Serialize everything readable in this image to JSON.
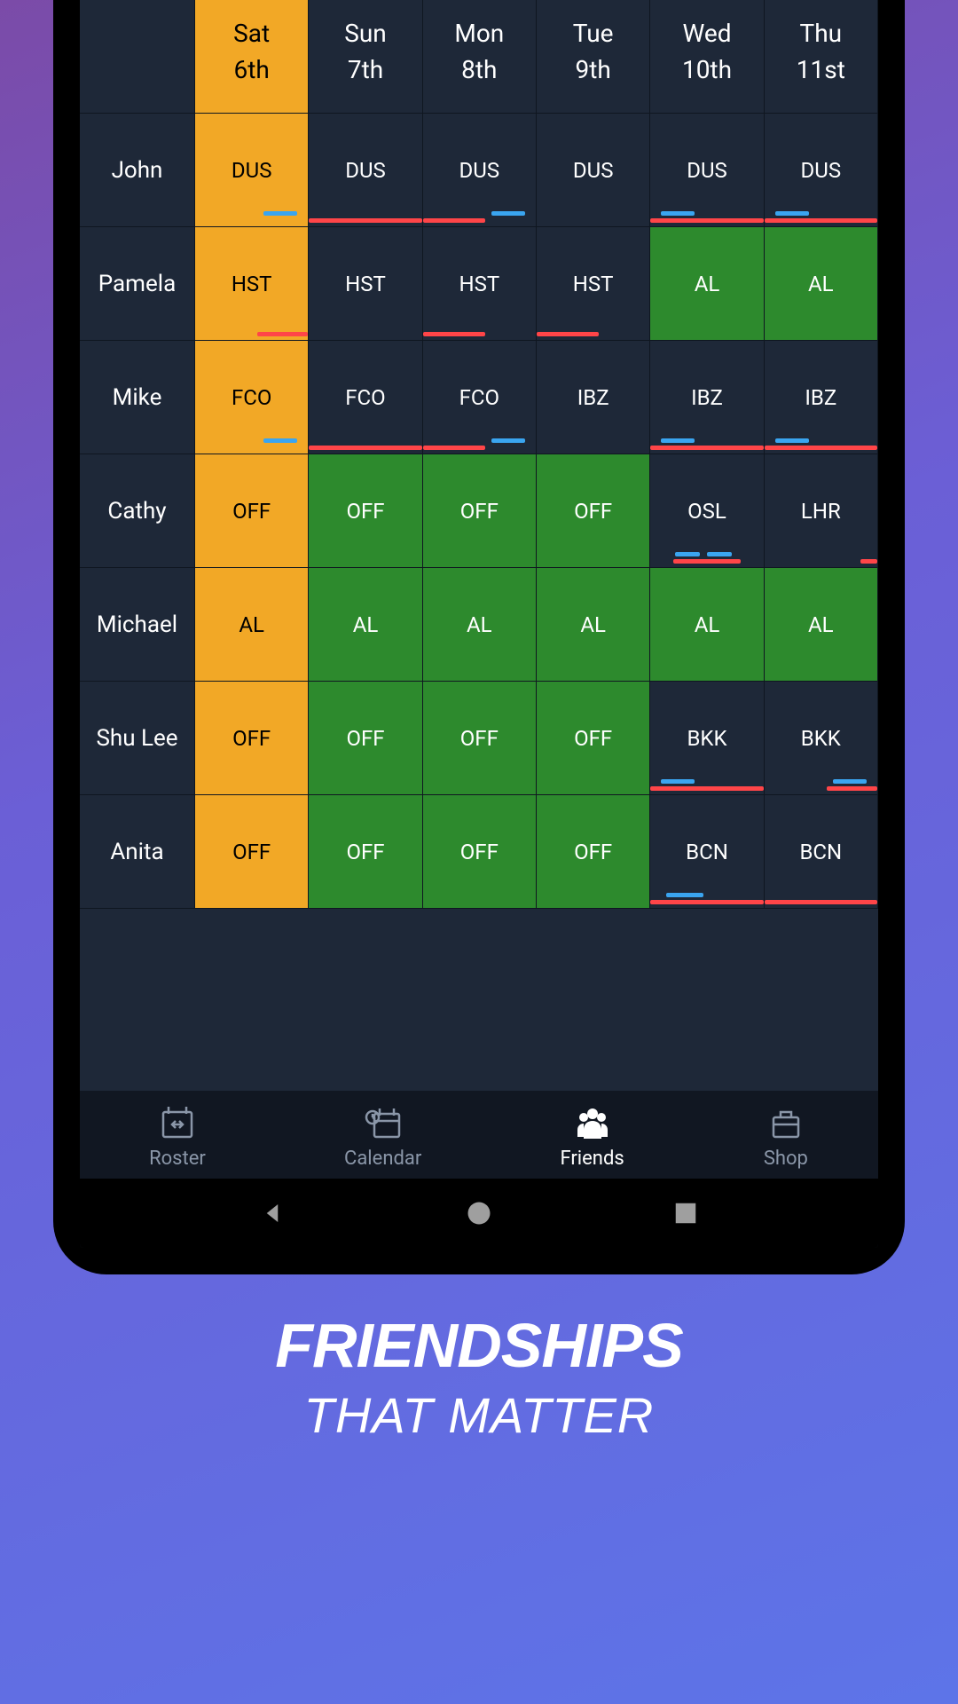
{
  "headers": [
    {
      "day": "Sat",
      "date": "6th",
      "highlight": true
    },
    {
      "day": "Sun",
      "date": "7th",
      "highlight": false
    },
    {
      "day": "Mon",
      "date": "8th",
      "highlight": false
    },
    {
      "day": "Tue",
      "date": "9th",
      "highlight": false
    },
    {
      "day": "Wed",
      "date": "10th",
      "highlight": false
    },
    {
      "day": "Thu",
      "date": "11st",
      "highlight": false
    }
  ],
  "rows": [
    {
      "name": "John",
      "cells": [
        {
          "text": "DUS",
          "style": "highlight",
          "blue": "right-short",
          "red": "none"
        },
        {
          "text": "DUS",
          "style": "",
          "blue": "",
          "red": "full"
        },
        {
          "text": "DUS",
          "style": "",
          "blue": "right-short",
          "red": "half-left"
        },
        {
          "text": "DUS",
          "style": "",
          "blue": "",
          "red": "none"
        },
        {
          "text": "DUS",
          "style": "",
          "blue": "left-short",
          "red": "full"
        },
        {
          "text": "DUS",
          "style": "",
          "blue": "left-short",
          "red": "full"
        }
      ]
    },
    {
      "name": "Pamela",
      "cells": [
        {
          "text": "HST",
          "style": "highlight",
          "blue": "",
          "red": "half-right"
        },
        {
          "text": "HST",
          "style": "",
          "blue": "",
          "red": "none"
        },
        {
          "text": "HST",
          "style": "",
          "blue": "",
          "red": "half-left"
        },
        {
          "text": "HST",
          "style": "",
          "blue": "",
          "red": "half-left"
        },
        {
          "text": "AL",
          "style": "green",
          "blue": "",
          "red": "none"
        },
        {
          "text": "AL",
          "style": "green",
          "blue": "",
          "red": "none"
        }
      ]
    },
    {
      "name": "Mike",
      "cells": [
        {
          "text": "FCO",
          "style": "highlight",
          "blue": "right-short",
          "red": "none"
        },
        {
          "text": "FCO",
          "style": "",
          "blue": "",
          "red": "full"
        },
        {
          "text": "FCO",
          "style": "",
          "blue": "right-short",
          "red": "half-left"
        },
        {
          "text": "IBZ",
          "style": "",
          "blue": "",
          "red": "none"
        },
        {
          "text": "IBZ",
          "style": "",
          "blue": "left-short",
          "red": "full"
        },
        {
          "text": "IBZ",
          "style": "",
          "blue": "left-short",
          "red": "full"
        }
      ]
    },
    {
      "name": "Cathy",
      "cells": [
        {
          "text": "OFF",
          "style": "highlight",
          "blue": "",
          "red": "none"
        },
        {
          "text": "OFF",
          "style": "green",
          "blue": "",
          "red": "none"
        },
        {
          "text": "OFF",
          "style": "green",
          "blue": "",
          "red": "none"
        },
        {
          "text": "OFF",
          "style": "green",
          "blue": "",
          "red": "none"
        },
        {
          "text": "OSL",
          "style": "",
          "blue": "center-double",
          "red": "half-center"
        },
        {
          "text": "LHR",
          "style": "",
          "blue": "",
          "red": "tiny-right"
        }
      ]
    },
    {
      "name": "Michael",
      "cells": [
        {
          "text": "AL",
          "style": "highlight",
          "blue": "",
          "red": "none"
        },
        {
          "text": "AL",
          "style": "green",
          "blue": "",
          "red": "none"
        },
        {
          "text": "AL",
          "style": "green",
          "blue": "",
          "red": "none"
        },
        {
          "text": "AL",
          "style": "green",
          "blue": "",
          "red": "none"
        },
        {
          "text": "AL",
          "style": "green",
          "blue": "",
          "red": "none"
        },
        {
          "text": "AL",
          "style": "green",
          "blue": "",
          "red": "none"
        }
      ]
    },
    {
      "name": "Shu Lee",
      "cells": [
        {
          "text": "OFF",
          "style": "highlight",
          "blue": "",
          "red": "none"
        },
        {
          "text": "OFF",
          "style": "green",
          "blue": "",
          "red": "none"
        },
        {
          "text": "OFF",
          "style": "green",
          "blue": "",
          "red": "none"
        },
        {
          "text": "OFF",
          "style": "green",
          "blue": "",
          "red": "none"
        },
        {
          "text": "BKK",
          "style": "",
          "blue": "left-short",
          "red": "full"
        },
        {
          "text": "BKK",
          "style": "",
          "blue": "right-short",
          "red": "half-right"
        }
      ]
    },
    {
      "name": "Anita",
      "cells": [
        {
          "text": "OFF",
          "style": "highlight",
          "blue": "",
          "red": "none"
        },
        {
          "text": "OFF",
          "style": "green",
          "blue": "",
          "red": "none"
        },
        {
          "text": "OFF",
          "style": "green",
          "blue": "",
          "red": "none"
        },
        {
          "text": "OFF",
          "style": "green",
          "blue": "",
          "red": "none"
        },
        {
          "text": "BCN",
          "style": "",
          "blue": "left-short2",
          "red": "full"
        },
        {
          "text": "BCN",
          "style": "",
          "blue": "",
          "red": "full"
        }
      ]
    }
  ],
  "nav": [
    {
      "label": "Roster",
      "icon": "roster-icon",
      "active": false
    },
    {
      "label": "Calendar",
      "icon": "calendar-icon",
      "active": false
    },
    {
      "label": "Friends",
      "icon": "friends-icon",
      "active": true
    },
    {
      "label": "Shop",
      "icon": "shop-icon",
      "active": false
    }
  ],
  "tagline": {
    "l1": "FRIENDSHIPS",
    "l2": "THAT MATTER"
  }
}
